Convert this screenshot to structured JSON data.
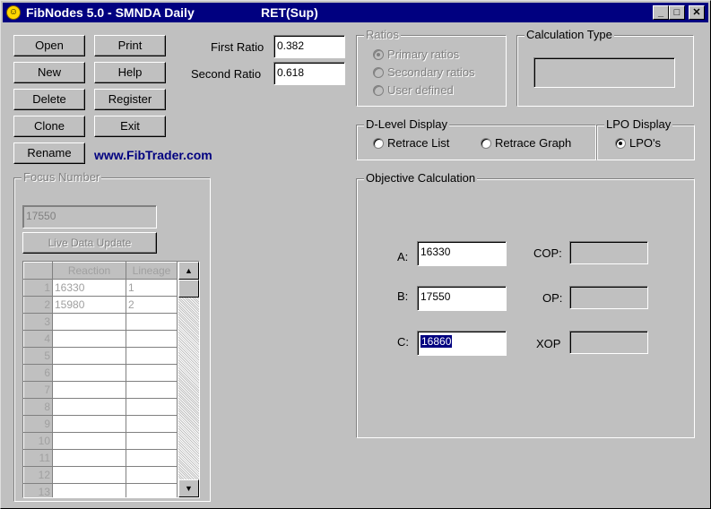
{
  "window": {
    "title": "FibNodes 5.0 - SMNDA Daily",
    "title_suffix": "RET(Sup)",
    "min_glyph": "_",
    "max_glyph": "□",
    "close_glyph": "✕"
  },
  "buttons": {
    "open": "Open",
    "print": "Print",
    "new": "New",
    "help": "Help",
    "delete": "Delete",
    "register": "Register",
    "clone": "Clone",
    "exit": "Exit",
    "rename": "Rename"
  },
  "ratios": {
    "first_label": "First Ratio",
    "first_value": "0.382",
    "second_label": "Second Ratio",
    "second_value": "0.618"
  },
  "ratios_group": {
    "title": "Ratios",
    "options": [
      "Primary ratios",
      "Secondary ratios",
      "User defined"
    ],
    "selected": 0
  },
  "calc_type": {
    "title": "Calculation Type",
    "value": ""
  },
  "website": "www.FibTrader.com",
  "dlevel": {
    "title": "D-Level Display",
    "option1": "Retrace List",
    "option2": "Retrace Graph"
  },
  "lpo": {
    "title": "LPO Display",
    "option": "LPO's"
  },
  "focus": {
    "title": "Focus Number",
    "value": "17550",
    "live_button": "Live Data Update"
  },
  "grid": {
    "headers": [
      "",
      "Reaction",
      "Lineage"
    ],
    "rows": [
      [
        "1",
        "16330",
        "1"
      ],
      [
        "2",
        "15980",
        "2"
      ],
      [
        "3",
        "",
        ""
      ],
      [
        "4",
        "",
        ""
      ],
      [
        "5",
        "",
        ""
      ],
      [
        "6",
        "",
        ""
      ],
      [
        "7",
        "",
        ""
      ],
      [
        "8",
        "",
        ""
      ],
      [
        "9",
        "",
        ""
      ],
      [
        "10",
        "",
        ""
      ],
      [
        "11",
        "",
        ""
      ],
      [
        "12",
        "",
        ""
      ],
      [
        "13",
        "",
        ""
      ]
    ]
  },
  "objective": {
    "title": "Objective Calculation",
    "a_label": "A:",
    "a_value": "16330",
    "b_label": "B:",
    "b_value": "17550",
    "c_label": "C:",
    "c_value": "16860",
    "cop_label": "COP:",
    "cop_value": "",
    "op_label": "OP:",
    "op_value": "",
    "xop_label": "XOP",
    "xop_value": ""
  }
}
